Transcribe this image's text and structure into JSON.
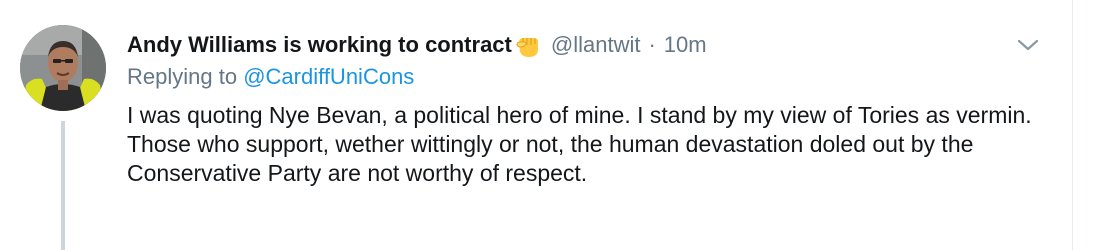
{
  "tweet": {
    "display_name": "Andy Williams is working to contract",
    "name_emoji_icon": "raised-fist-emoji-icon",
    "handle": "@llantwit",
    "separator": "·",
    "time": "10m",
    "replying_prefix": "Replying to",
    "replying_to": "@CardiffUniCons",
    "text_paragraphs": [
      "I was quoting Nye Bevan, a political hero of mine. I stand by my view of Tories as vermin.",
      "Those who support, wether wittingly or not, the human devastation doled out by the Conservative Party are not worthy of respect."
    ],
    "menu_icon": "chevron-down-icon",
    "colors": {
      "text": "#14171a",
      "secondary": "#657786",
      "link": "#1b95e0",
      "thread_line": "#ccd6dd",
      "border": "#e6ecf0"
    }
  }
}
